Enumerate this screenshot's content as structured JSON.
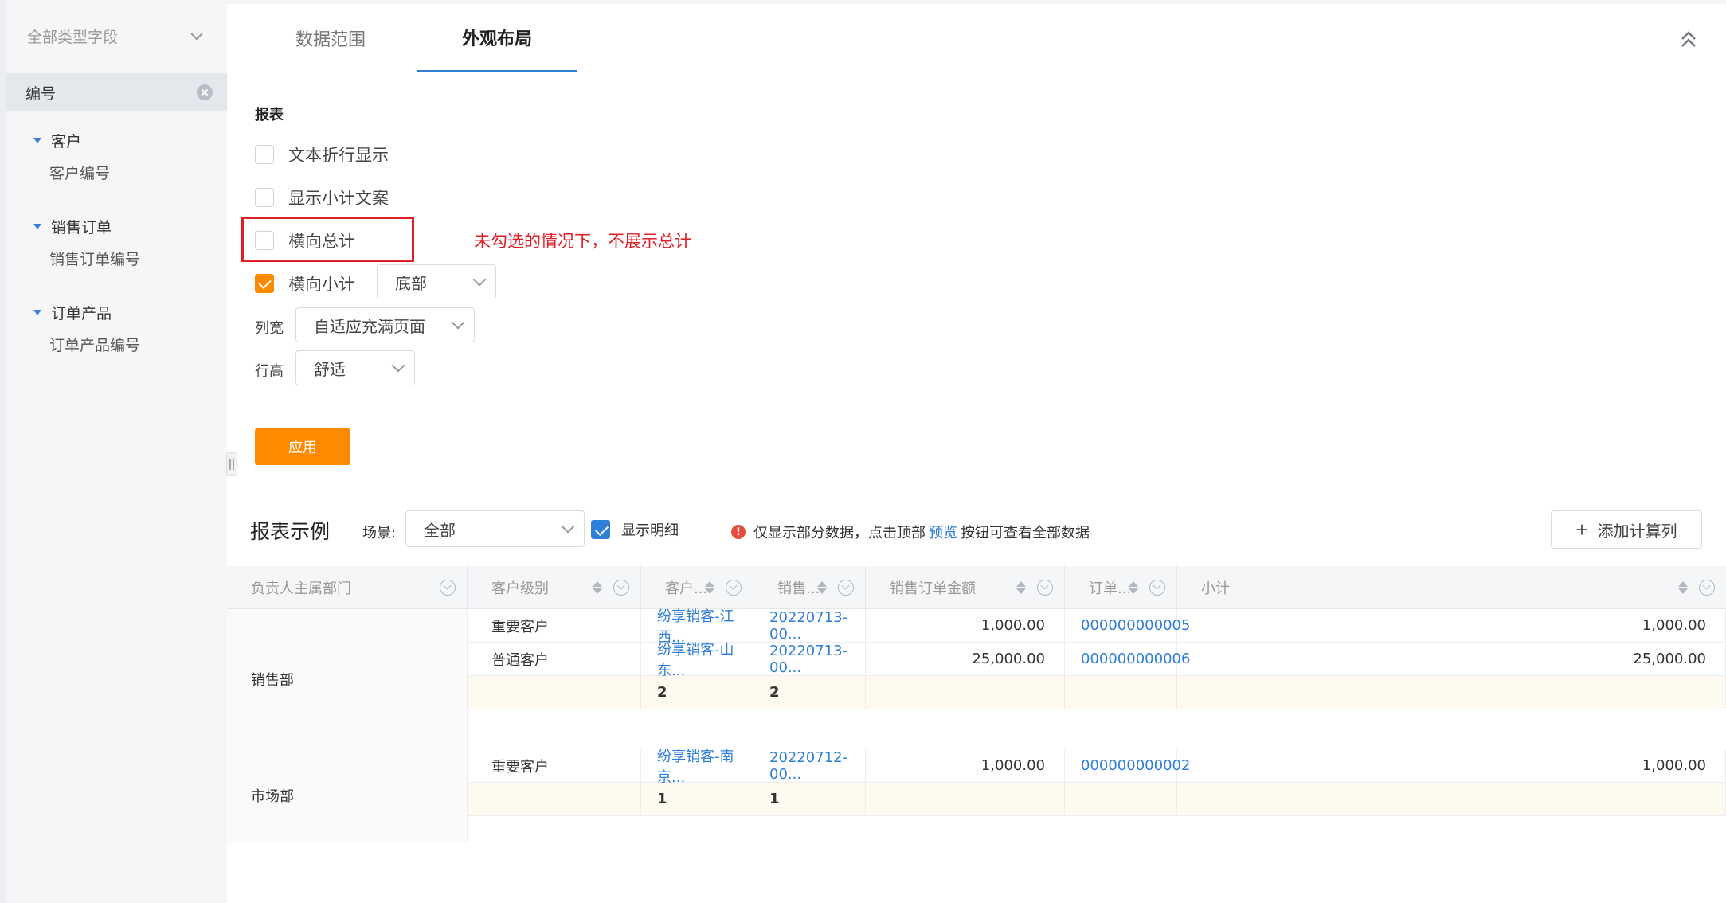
{
  "sidebar": {
    "field_type_select": "全部类型字段",
    "selected_field": "编号",
    "groups": [
      {
        "label": "客户",
        "child": "客户编号"
      },
      {
        "label": "销售订单",
        "child": "销售订单编号"
      },
      {
        "label": "订单产品",
        "child": "订单产品编号"
      }
    ]
  },
  "tabs": [
    "数据范围",
    "外观布局"
  ],
  "panel": {
    "section_title": "报表",
    "options": [
      {
        "label": "文本折行显示",
        "checked": false
      },
      {
        "label": "显示小计文案",
        "checked": false
      },
      {
        "label": "横向总计",
        "checked": false
      },
      {
        "label": "横向小计",
        "checked": true
      }
    ],
    "subtotal_position": "底部",
    "annotation": "未勾选的情况下，不展示总计",
    "col_width_label": "列宽",
    "col_width_value": "自适应充满页面",
    "row_height_label": "行高",
    "row_height_value": "舒适",
    "apply_label": "应用"
  },
  "report": {
    "title": "报表示例",
    "scene_label": "场景:",
    "scene_value": "全部",
    "show_detail_label": "显示明细",
    "note_prefix": "仅显示部分数据，点击顶部",
    "note_link": "预览",
    "note_suffix": "按钮可查看全部数据",
    "add_column_label": "添加计算列",
    "columns": [
      "负责人主属部门",
      "客户级别",
      "客户...",
      "销售...",
      "销售订单金额",
      "订单...",
      "小计"
    ],
    "rows": [
      {
        "dept": "销售部",
        "level": "重要客户",
        "customer": "纷享销客-江西...",
        "order": "20220713-00...",
        "amount": "1,000.00",
        "product": "000000000005",
        "subtotal": "1,000.00"
      },
      {
        "dept": "",
        "level": "普通客户",
        "customer": "纷享销客-山东...",
        "order": "20220713-00...",
        "amount": "25,000.00",
        "product": "000000000006",
        "subtotal": "25,000.00"
      },
      {
        "dept": "",
        "level": "",
        "customer": "2",
        "order": "2",
        "amount": "",
        "product": "",
        "subtotal": ""
      },
      {
        "dept": "市场部",
        "level": "重要客户",
        "customer": "纷享销客-南京...",
        "order": "20220712-00...",
        "amount": "1,000.00",
        "product": "000000000002",
        "subtotal": "1,000.00"
      },
      {
        "dept": "",
        "level": "",
        "customer": "1",
        "order": "1",
        "amount": "",
        "product": "",
        "subtotal": ""
      }
    ]
  },
  "colors": {
    "accent": "#ff8a00",
    "link": "#2f7ed8",
    "alert": "#e01e26"
  }
}
